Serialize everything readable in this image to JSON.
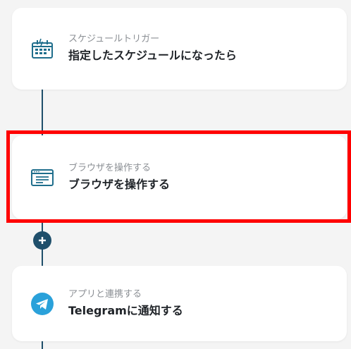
{
  "flow": {
    "steps": [
      {
        "subtitle": "スケジュールトリガー",
        "title": "指定したスケジュールになったら",
        "icon": "calendar-schedule-icon"
      },
      {
        "subtitle": "ブラウザを操作する",
        "title": "ブラウザを操作する",
        "icon": "browser-window-icon"
      },
      {
        "subtitle": "アプリと連携する",
        "title": "Telegramに通知する",
        "icon": "telegram-icon"
      }
    ],
    "add_button_icon": "plus-icon"
  },
  "colors": {
    "accent": "#1f4f6b",
    "highlight": "#ff0000",
    "telegram": "#2aa1da",
    "background": "#f4f4f4"
  }
}
